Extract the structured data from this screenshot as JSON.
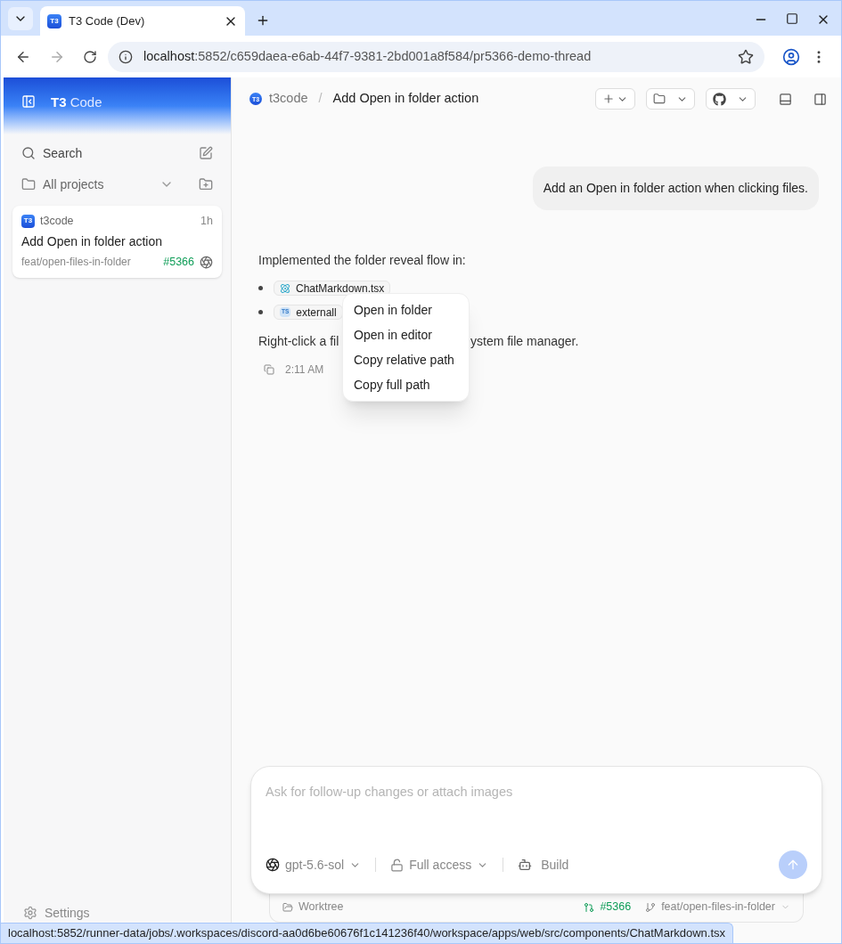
{
  "browser": {
    "tab_logo": "T3",
    "tab_title": "T3 Code (Dev)",
    "url_host": "localhost",
    "url_rest": ":5852/c659daea-e6ab-44f7-9381-2bd001a8f584/pr5366-demo-thread"
  },
  "sidebar": {
    "brand_bold": "T3",
    "brand_rest": "Code",
    "search_label": "Search",
    "projects_label": "All projects",
    "threads": [
      {
        "project_logo": "T3",
        "project": "t3code",
        "age": "1h",
        "title": "Add Open in folder action",
        "branch": "feat/open-files-in-folder",
        "pr": "#5366",
        "selected": true
      }
    ],
    "settings_label": "Settings"
  },
  "header": {
    "logo": "T3",
    "project": "t3code",
    "separator": "/",
    "title": "Add Open in folder action"
  },
  "messages": [
    {
      "kind": "user",
      "text": "Add an Open in folder action when clicking files."
    },
    {
      "kind": "assistant",
      "intro": "Implemented the folder reveal flow in:",
      "files": [
        {
          "kind": "react",
          "name": "ChatMarkdown.tsx"
        },
        {
          "kind": "ts",
          "badge": "TS",
          "name": "externall"
        }
      ],
      "outro_before": "Right-click a fil",
      "outro_after": "ystem file manager.",
      "time": "2:11 AM"
    }
  ],
  "context_menu": {
    "items": [
      "Open in folder",
      "Open in editor",
      "Copy relative path",
      "Copy full path"
    ]
  },
  "composer": {
    "placeholder": "Ask for follow-up changes or attach images",
    "model": "gpt-5.6-sol",
    "access": "Full access",
    "mode": "Build",
    "send_disabled": true
  },
  "footer": {
    "worktree": "Worktree",
    "pr": "#5366",
    "branch": "feat/open-files-in-folder"
  },
  "status_bar": "localhost:5852/runner-data/jobs/.workspaces/discord-aa0d6be60676f1c141236f40/workspace/apps/web/src/components/ChatMarkdown.tsx"
}
